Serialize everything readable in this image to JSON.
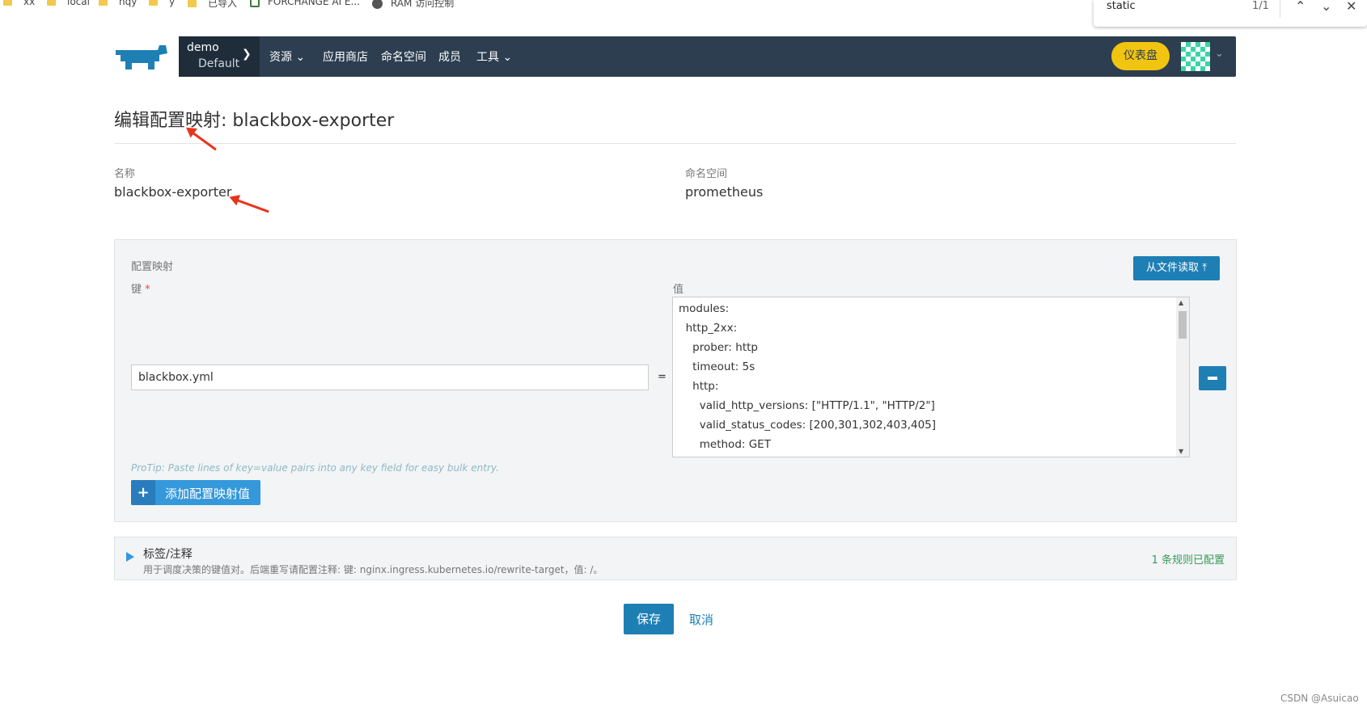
{
  "bookmarks": [
    {
      "label": "xx",
      "icon": "folder-icon"
    },
    {
      "label": "local",
      "icon": "folder-icon"
    },
    {
      "label": "hqy",
      "icon": "folder-icon"
    },
    {
      "label": "y",
      "icon": "folder-icon"
    },
    {
      "label": "已导入",
      "icon": "folder-icon"
    },
    {
      "label": "FORCHANGE AI E...",
      "icon": "page-icon"
    },
    {
      "label": "RAM 访问控制",
      "icon": "globe-icon"
    }
  ],
  "find_bar": {
    "query": "static",
    "count": "1/1"
  },
  "navbar": {
    "cluster": "demo",
    "project": "Default",
    "items": [
      "资源",
      "应用商店",
      "命名空间",
      "成员",
      "工具"
    ],
    "dashboard_label": "仪表盘"
  },
  "page": {
    "title": "编辑配置映射: blackbox-exporter",
    "name_label": "名称",
    "name_value": "blackbox-exporter",
    "namespace_label": "命名空间",
    "namespace_value": "prometheus"
  },
  "config_map": {
    "section_label": "配置映射",
    "read_file_label": "从文件读取",
    "key_label": "键",
    "required_mark": "*",
    "value_label": "值",
    "key_value": "blackbox.yml",
    "equals": "=",
    "value_lines": [
      "modules:",
      "  http_2xx:",
      "    prober: http",
      "    timeout: 5s",
      "    http:",
      "      valid_http_versions: [\"HTTP/1.1\", \"HTTP/2\"]",
      "      valid_status_codes: [200,301,302,403,405]",
      "      method: GET"
    ],
    "protip": "ProTip: Paste lines of key=value pairs into any key field for easy bulk entry.",
    "add_label": "添加配置映射值"
  },
  "labels": {
    "title": "标签/注释",
    "description": "用于调度决策的键值对。后端重写请配置注释: 键: nginx.ingress.kubernetes.io/rewrite-target，值: /。",
    "rules_configured": "1 条规则已配置"
  },
  "actions": {
    "save": "保存",
    "cancel": "取消"
  },
  "watermark": "CSDN @Asuicao",
  "colors": {
    "navbar": "#2c3e50",
    "primary": "#1e7fb5",
    "dashboard": "#f1c40f",
    "annotation_arrow": "#e8341c"
  }
}
